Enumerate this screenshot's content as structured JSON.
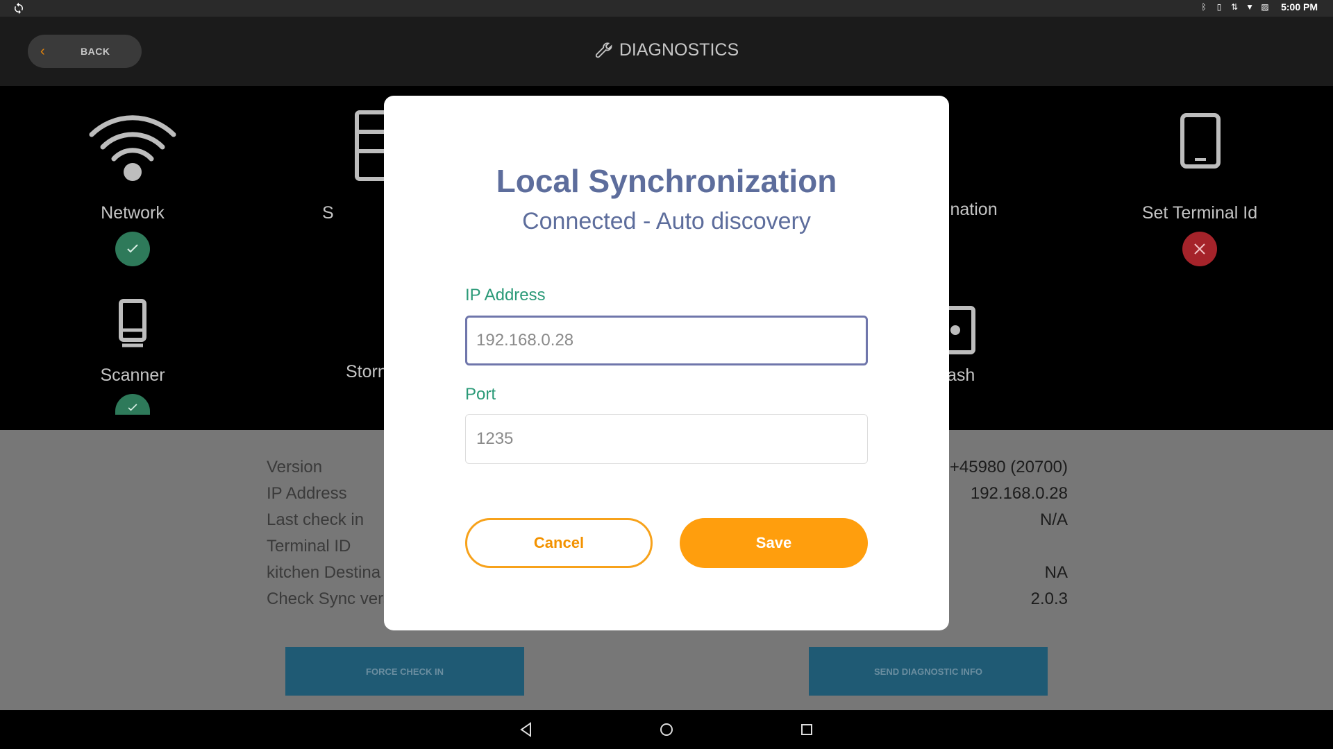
{
  "status_bar": {
    "time": "5:00 PM",
    "icons": [
      "bluetooth-icon",
      "vibrate-icon",
      "data-icon",
      "wifi-icon",
      "no-sim-icon"
    ]
  },
  "header": {
    "back_label": "BACK",
    "title": "DIAGNOSTICS"
  },
  "tiles": [
    {
      "label": "Network",
      "status": "ok"
    },
    {
      "label": "S",
      "status": ""
    },
    {
      "label": "tination",
      "status": ""
    },
    {
      "label": "Set Terminal Id",
      "status": "error"
    },
    {
      "label": "Scanner",
      "status": "ok"
    },
    {
      "label": "Storn",
      "status": ""
    },
    {
      "label": "ash",
      "status": ""
    }
  ],
  "info": {
    "labels": [
      "Version",
      "IP Address",
      "Last check in",
      "Terminal ID",
      "kitchen Destina",
      "Check Sync vers"
    ],
    "values": [
      ")+45980 (20700)",
      "192.168.0.28",
      "N/A",
      "",
      "NA",
      "2.0.3"
    ],
    "force_check_in": "FORCE CHECK IN",
    "send_diagnostic": "SEND DIAGNOSTIC INFO"
  },
  "modal": {
    "title": "Local Synchronization",
    "subtitle": "Connected - Auto discovery",
    "ip_label": "IP Address",
    "ip_value": "192.168.0.28",
    "port_label": "Port",
    "port_value": "1235",
    "cancel_label": "Cancel",
    "save_label": "Save"
  },
  "colors": {
    "accent": "#ff9e0d",
    "title": "#5d6d9c",
    "field_label": "#2b9a78",
    "ok": "#2e7a5a",
    "error": "#a5232a"
  }
}
